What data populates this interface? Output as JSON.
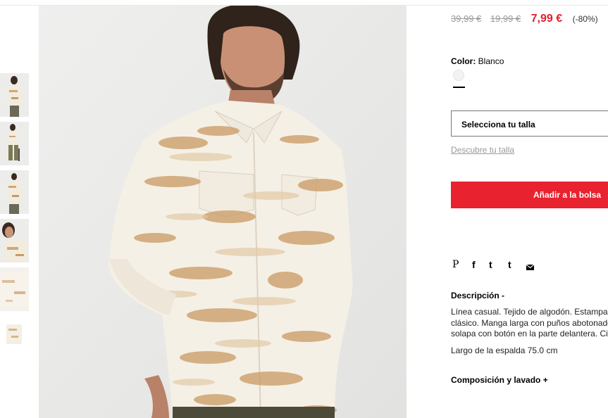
{
  "price": {
    "original_1": "39,99 €",
    "original_2": "19,99 €",
    "current": "7,99 €",
    "discount": "(-80%)"
  },
  "color": {
    "label": "Color:",
    "value": "Blanco",
    "swatch_color": "#f3f3f6"
  },
  "size": {
    "select_label": "Selecciona tu talla",
    "guide_link": "Descubre tu talla"
  },
  "cart": {
    "add_button": "Añadir a la bolsa",
    "button_color": "#e8222e"
  },
  "share": {
    "icons": [
      "pinterest-icon",
      "facebook-icon",
      "twitter-icon",
      "tumblr-icon",
      "email-icon"
    ],
    "pinterest": "P",
    "facebook": "f",
    "twitter": "t",
    "tumblr": "t"
  },
  "description": {
    "title": "Descripción -",
    "lines": [
      "Línea casual. Tejido de algodón. Estampad",
      "clásico. Manga larga con puños abotonado",
      "solapa con botón en la parte delantera. Ci"
    ],
    "back_length": "Largo de la espalda 75.0 cm"
  },
  "composition": {
    "title": "Composición y lavado +"
  },
  "thumbnails": {
    "count": 6,
    "selected_index": 0
  },
  "accent_color": "#e0212c"
}
